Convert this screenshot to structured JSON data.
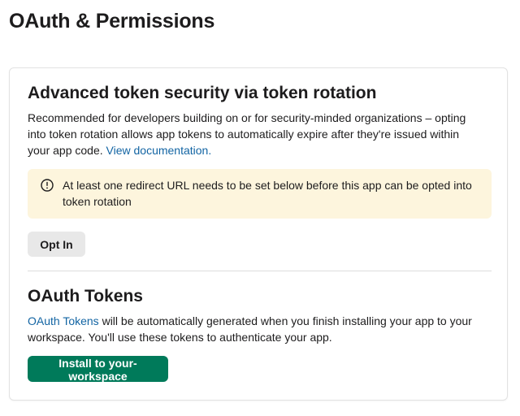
{
  "page": {
    "title": "OAuth & Permissions"
  },
  "token_rotation": {
    "heading": "Advanced token security via token rotation",
    "description": "Recommended for developers building on or for security-minded organizations – opting into token rotation allows app tokens to automatically expire after they're issued within your app code.",
    "doc_link": "View documentation.",
    "warning": {
      "icon": "warning-circle-icon",
      "text": "At least one redirect URL needs to be set below before this app can be opted into token rotation"
    },
    "opt_in_label": "Opt In"
  },
  "oauth_tokens": {
    "heading": "OAuth Tokens",
    "link_text": "OAuth Tokens",
    "description": " will be automatically generated when you finish installing your app to your workspace. You'll use these tokens to authenticate your app.",
    "install_label": "Install to your-workspace"
  },
  "colors": {
    "link": "#1264a3",
    "primary_button": "#007a5a",
    "warning_background": "#fdf5dd",
    "secondary_button": "#e8e8e8"
  }
}
